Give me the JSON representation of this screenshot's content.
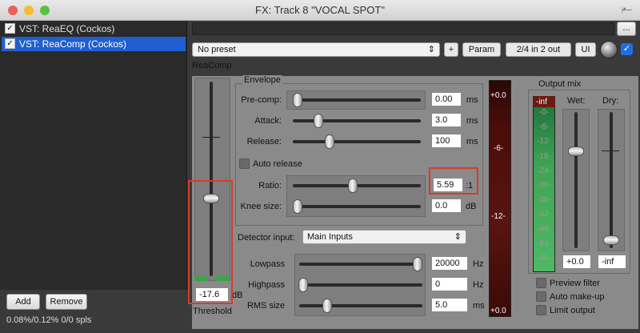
{
  "window": {
    "title": "FX: Track 8 \"VOCAL SPOT\""
  },
  "fx_list": [
    {
      "label": "VST: ReaEQ (Cockos)",
      "checked": true,
      "selected": false
    },
    {
      "label": "VST: ReaComp (Cockos)",
      "checked": true,
      "selected": true
    }
  ],
  "left_bottom": {
    "add_label": "Add",
    "remove_label": "Remove",
    "stats": "0.08%/0.12% 0/0 spls"
  },
  "toolbar": {
    "more_label": "...",
    "preset": "No preset",
    "plus_label": "+",
    "param_label": "Param",
    "io_label": "2/4 in 2 out",
    "ui_label": "UI"
  },
  "plugin": {
    "name": "ReaComp",
    "threshold": {
      "label": "Threshold",
      "value": "-17.6",
      "unit": "dB"
    },
    "envelope": {
      "title": "Envelope",
      "precomp": {
        "label": "Pre-comp:",
        "value": "0.00",
        "unit": "ms"
      },
      "attack": {
        "label": "Attack:",
        "value": "3.0",
        "unit": "ms"
      },
      "release": {
        "label": "Release:",
        "value": "100",
        "unit": "ms"
      },
      "auto_release": "Auto release",
      "ratio": {
        "label": "Ratio:",
        "value": "5.59",
        "unit": ":1"
      },
      "knee": {
        "label": "Knee size:",
        "value": "0.0",
        "unit": "dB"
      }
    },
    "detector": {
      "label": "Detector input:",
      "value": "Main Inputs"
    },
    "lowpass": {
      "label": "Lowpass",
      "value": "20000",
      "unit": "Hz"
    },
    "highpass": {
      "label": "Highpass",
      "value": "0",
      "unit": "Hz"
    },
    "rms": {
      "label": "RMS size",
      "value": "5.0",
      "unit": "ms"
    },
    "gr_meter": {
      "top": "+0.0",
      "mid1": "-6-",
      "mid2": "-12-",
      "bottom": "+0.0"
    },
    "output_mix": {
      "title": "Output mix",
      "inf_label": "-inf",
      "wet_label": "Wet:",
      "dry_label": "Dry:",
      "scale": [
        "-0-",
        "-6-",
        "-12-",
        "-18-",
        "-24-",
        "-30-",
        "-36-",
        "-42-",
        "-48-",
        "-54-",
        "-60-"
      ],
      "wet_value": "+0.0",
      "dry_value": "-inf",
      "preview_filter": "Preview filter",
      "auto_makeup": "Auto make-up",
      "limit_output": "Limit output"
    }
  },
  "colors": {
    "selection": "#1f5fd0",
    "meter_green": "#3da34a",
    "highlight_red": "#d93a2a",
    "meter_dark_red": "#4a0d0a"
  }
}
